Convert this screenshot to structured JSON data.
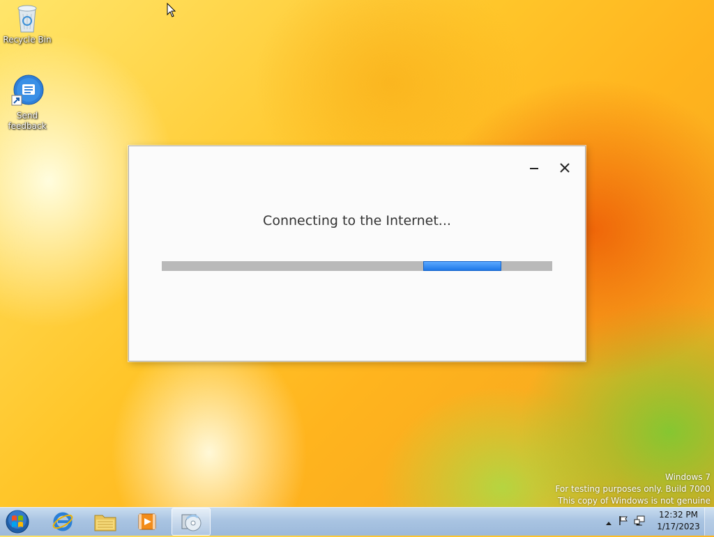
{
  "desktop": {
    "icons": [
      {
        "label": "Recycle Bin",
        "icon": "recycle-bin-icon"
      },
      {
        "label_line1": "Send",
        "label_line2": "feedback",
        "icon": "send-feedback-icon"
      }
    ]
  },
  "dialog": {
    "message": "Connecting to the Internet...",
    "progress": {
      "state": "indeterminate",
      "chunk_start": 0.67,
      "chunk_end": 0.87,
      "accent": "#1f78e8"
    }
  },
  "watermark": {
    "line1": "Windows  7",
    "line2": "For testing purposes only. Build 7000",
    "line3": "This copy of Windows is not genuine"
  },
  "taskbar": {
    "apps": [
      "start-orb-icon",
      "internet-explorer-icon",
      "windows-explorer-icon",
      "media-player-icon",
      "setup-disc-icon"
    ],
    "clock": {
      "time": "12:32 PM",
      "date": "1/17/2023"
    }
  }
}
